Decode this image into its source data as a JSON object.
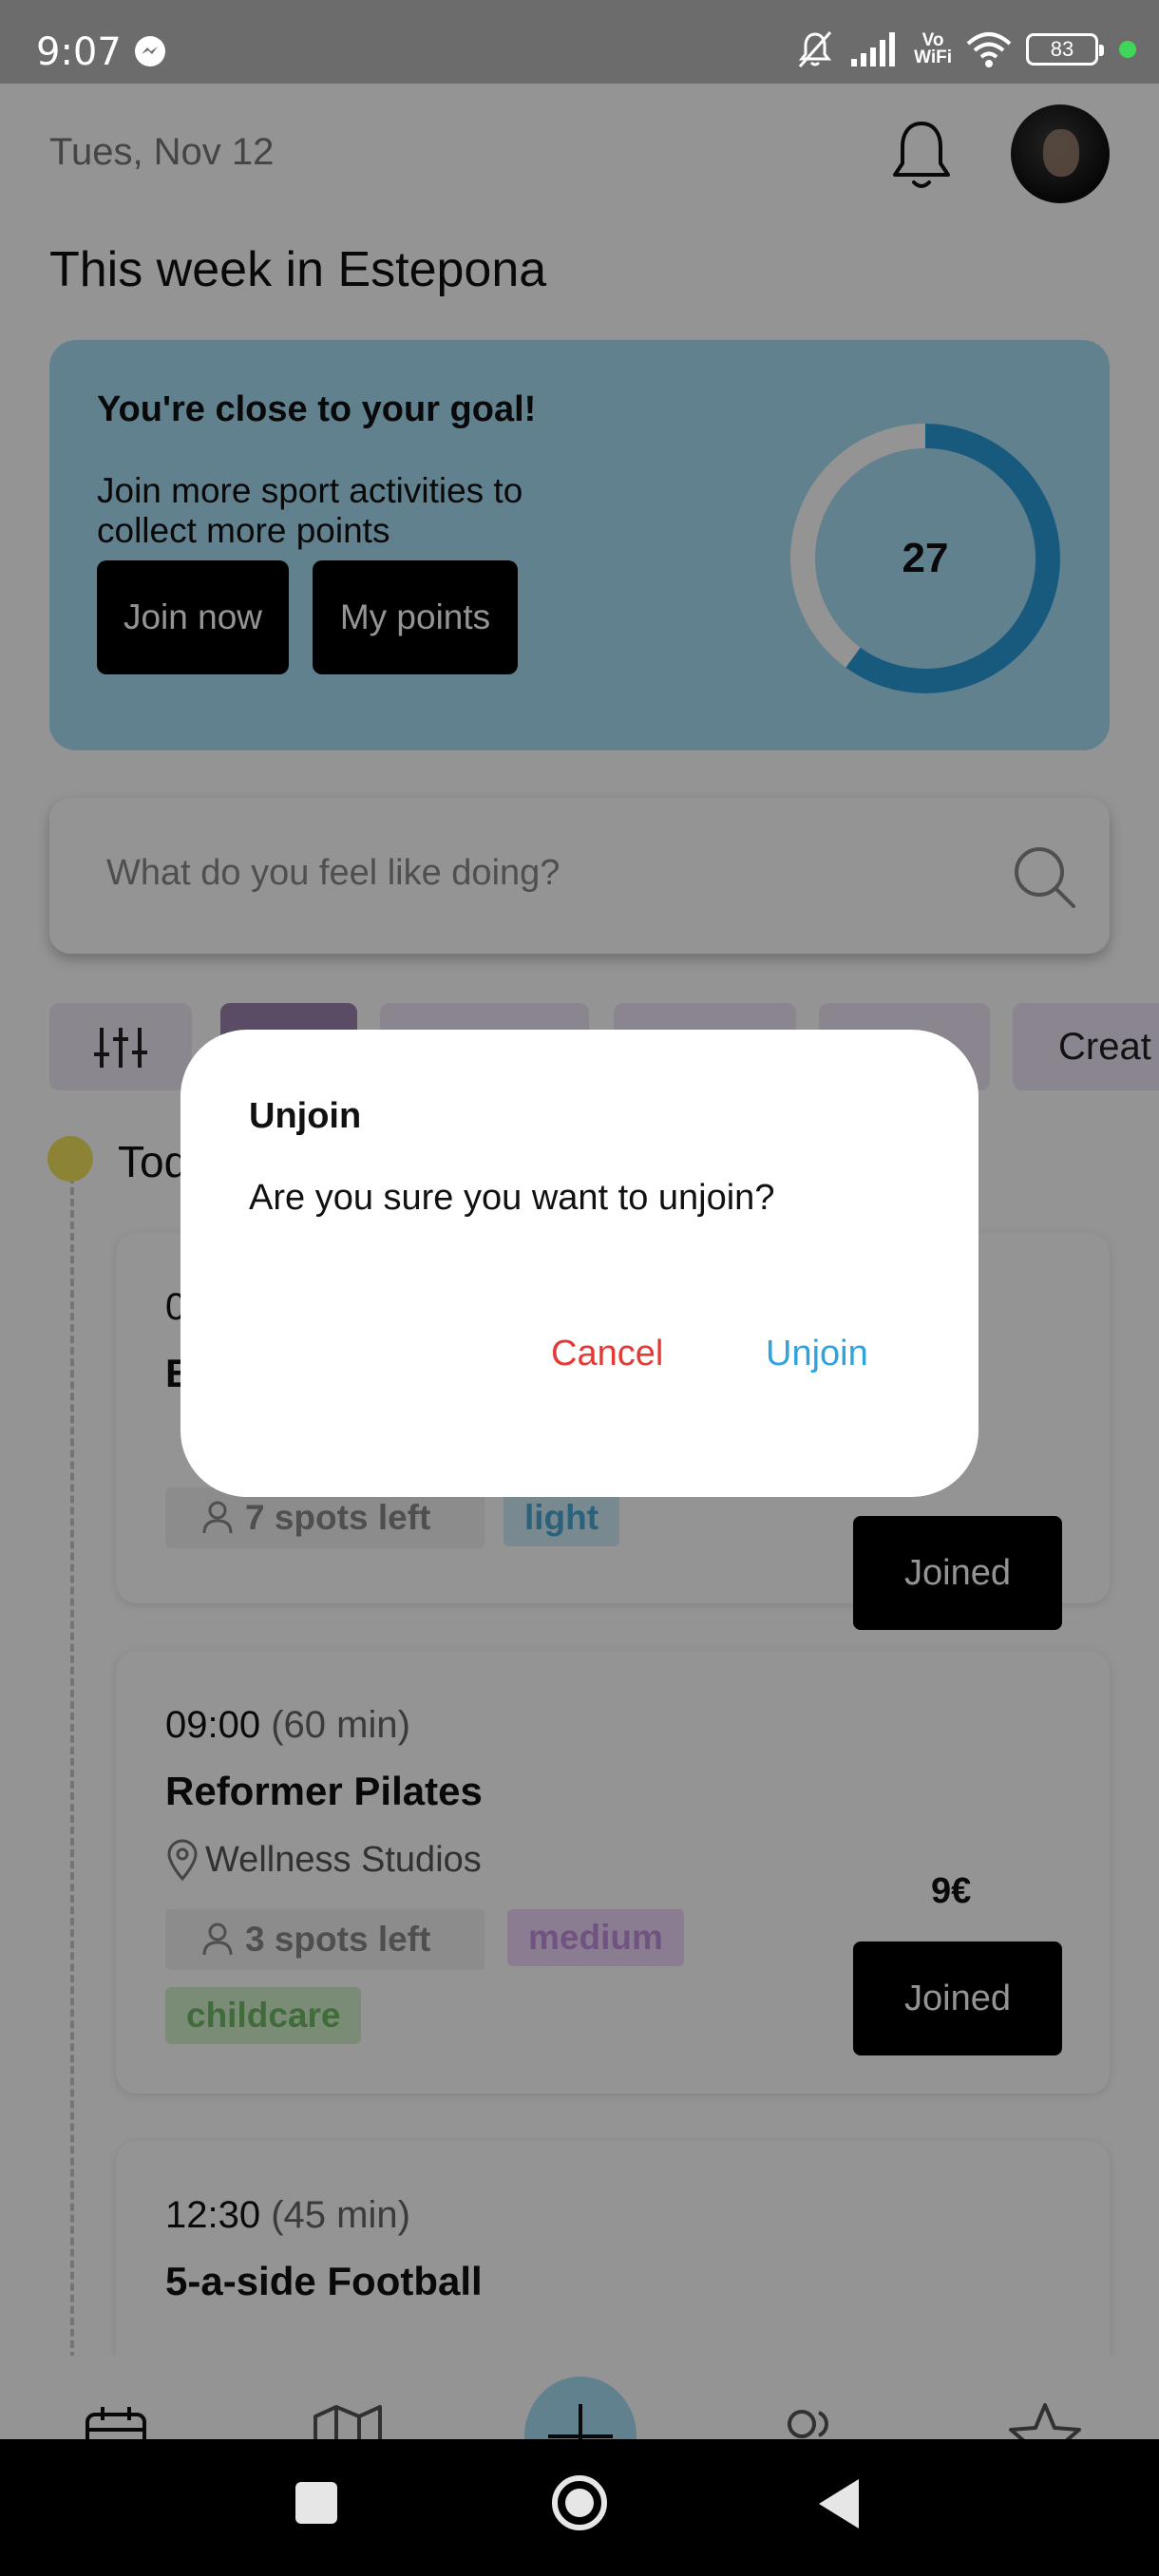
{
  "status_bar": {
    "time": "9:07",
    "vowifi_top": "Vo",
    "vowifi_bottom": "WiFi",
    "battery": "83",
    "icons": [
      "messenger-icon",
      "mute-icon",
      "signal-icon",
      "wifi-icon",
      "battery-icon"
    ]
  },
  "header": {
    "date": "Tues, Nov 12",
    "title": "This week in Estepona"
  },
  "goal_card": {
    "title": "You're close to your goal!",
    "text": "Join more sport activities to collect more points",
    "join_now": "Join now",
    "my_points": "My points",
    "points": "27",
    "progress_fraction": 0.6,
    "colors": {
      "background": "#a8def7",
      "ring": "#2a9bd8",
      "ring_track": "#ffffff"
    }
  },
  "search": {
    "placeholder": "What do you feel like doing?"
  },
  "chips": {
    "create_label": "Creat"
  },
  "timeline": {
    "today_label": "Tod"
  },
  "events": [
    {
      "time": "0",
      "duration": "",
      "name": "E",
      "location": "",
      "spots": "7 spots left",
      "tags": [
        "light"
      ],
      "price": "",
      "button": "Joined"
    },
    {
      "time": "09:00",
      "duration": "(60 min)",
      "name": "Reformer Pilates",
      "location": "Wellness Studios",
      "spots": "3 spots left",
      "tags": [
        "medium",
        "childcare"
      ],
      "price": "9€",
      "button": "Joined"
    },
    {
      "time": "12:30",
      "duration": "(45 min)",
      "name": "5-a-side Football"
    }
  ],
  "bottom_nav": {
    "items": [
      "calendar-icon",
      "map-icon",
      "add-icon",
      "people-icon",
      "star-icon"
    ]
  },
  "dialog": {
    "title": "Unjoin",
    "message": "Are you sure you want to unjoin?",
    "cancel": "Cancel",
    "confirm": "Unjoin",
    "colors": {
      "cancel": "#e53935",
      "confirm": "#2fa3dd"
    }
  }
}
